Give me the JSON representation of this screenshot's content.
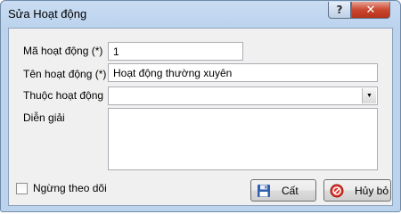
{
  "window": {
    "title": "Sửa Hoạt động"
  },
  "titlebar": {
    "help_glyph": "?",
    "close_glyph": "✕"
  },
  "form": {
    "code_label": "Mã hoạt động (*)",
    "code_value": "1",
    "name_label": "Tên hoạt động (*)",
    "name_value": "Hoạt động thường xuyên",
    "parent_label": "Thuộc hoạt động",
    "parent_value": "",
    "desc_label": "Diễn giải",
    "desc_value": "",
    "inactive_label": "Ngừng theo dõi",
    "inactive_checked": false
  },
  "buttons": {
    "save_label": "Cất",
    "cancel_label": "Hủy bỏ"
  },
  "icons": {
    "save": "floppy-disk-icon",
    "cancel": "cancel-circle-icon",
    "dropdown": "dropdown-arrow-icon"
  }
}
